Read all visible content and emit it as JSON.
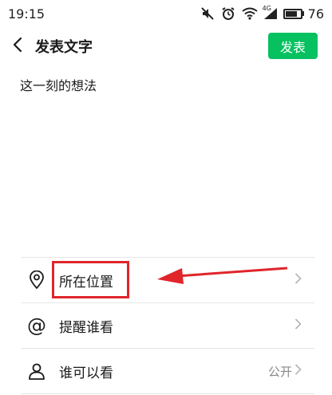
{
  "status_bar": {
    "time": "19:15",
    "network": "4G",
    "battery_percent": "76",
    "battery_level": 0.76
  },
  "header": {
    "back_icon": "chevron-left-icon",
    "title": "发表文字",
    "publish_label": "发表"
  },
  "composer": {
    "placeholder": "这一刻的想法",
    "value": ""
  },
  "options": [
    {
      "icon": "location-pin-icon",
      "label": "所在位置",
      "value": ""
    },
    {
      "icon": "at-sign-icon",
      "label": "提醒谁看",
      "value": ""
    },
    {
      "icon": "person-icon",
      "label": "谁可以看",
      "value": "公开"
    }
  ],
  "colors": {
    "accent": "#07c160",
    "annotation": "#e0252b",
    "divider": "#e6e6e6",
    "secondary_text": "#8a8a8a"
  }
}
